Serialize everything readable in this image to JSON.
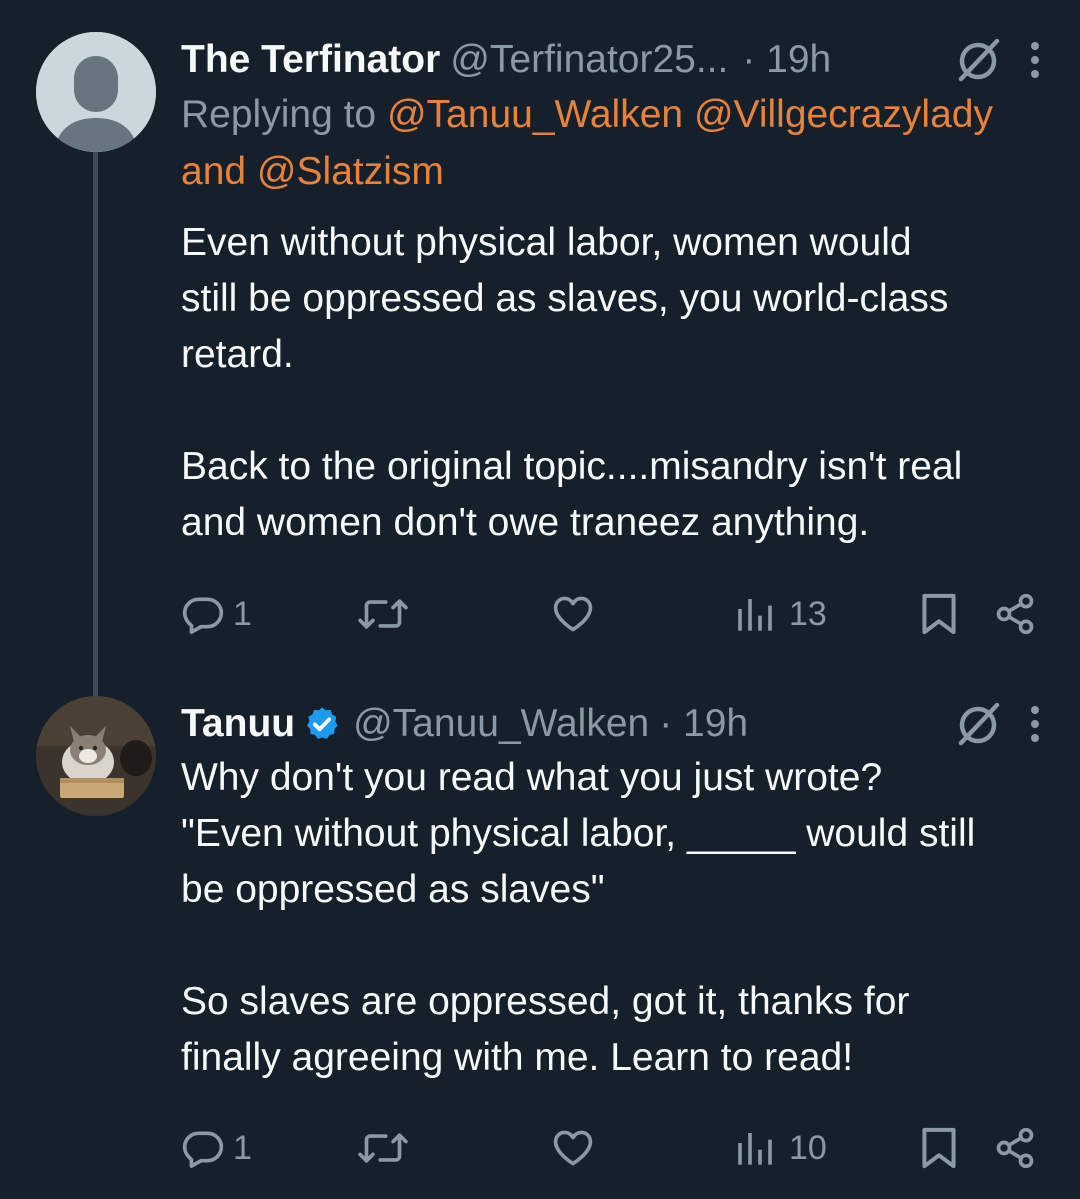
{
  "colors": {
    "background": "#15202b",
    "text_primary": "#f7f9f9",
    "text_secondary": "#8b98a5",
    "mention": "#e8823a",
    "verified_badge": "#1d9bf0",
    "thread_line": "#3e4c5a"
  },
  "tweets": [
    {
      "name": "The Terfinator",
      "handle": "@Terfinator25...",
      "time": "· 19h",
      "verified": false,
      "reply": {
        "prefix": "Replying to",
        "mention_1": "@Tanuu_Walken",
        "mention_2": "@Villgecrazylady",
        "joiner": "and",
        "mention_3": "@Slatzism"
      },
      "body_lines": [
        "Even without physical labor, women would",
        "still be oppressed as slaves, you world-class",
        "retard."
      ],
      "body_lines_2": [
        "Back to the original topic....misandry isn't real",
        "and women don't owe traneez anything."
      ],
      "stats": {
        "replies": "1",
        "reposts": "",
        "likes": "",
        "views": "13"
      },
      "icons": [
        "grok-icon",
        "more-icon",
        "reply-icon",
        "repost-icon",
        "like-icon",
        "views-icon",
        "bookmark-icon",
        "share-icon"
      ]
    },
    {
      "name": "Tanuu",
      "handle": "@Tanuu_Walken",
      "time": "· 19h",
      "verified": true,
      "body_lines": [
        "Why don't you read what you just wrote?",
        "\"Even without physical labor, _____ would still",
        "be oppressed as slaves\""
      ],
      "body_lines_2": [
        "So slaves are oppressed, got it, thanks for",
        "finally agreeing with me.  Learn to read!"
      ],
      "stats": {
        "replies": "1",
        "reposts": "",
        "likes": "",
        "views": "10"
      },
      "icons": [
        "verified-badge-icon",
        "grok-icon",
        "more-icon",
        "reply-icon",
        "repost-icon",
        "like-icon",
        "views-icon",
        "bookmark-icon",
        "share-icon"
      ]
    }
  ]
}
